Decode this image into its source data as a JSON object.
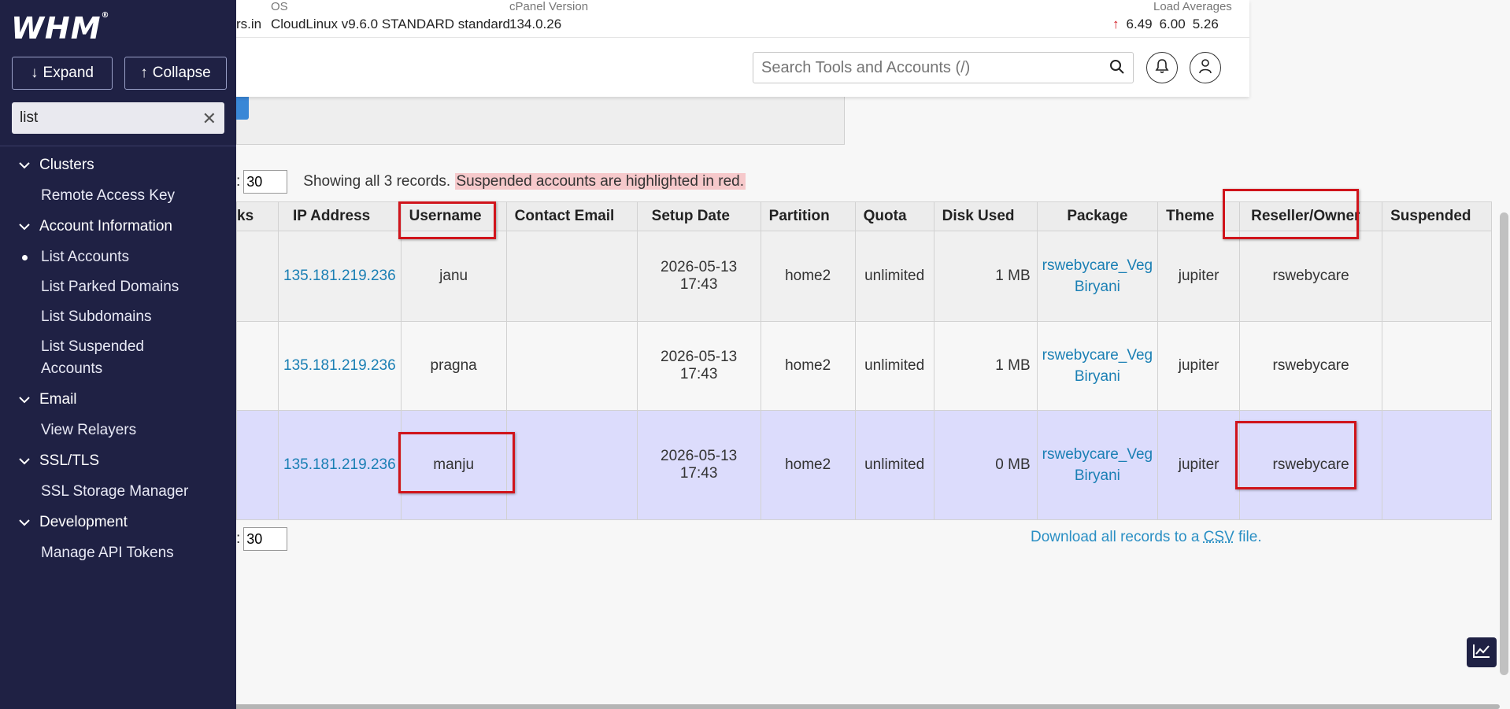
{
  "sidebar": {
    "logo": "WHM",
    "expand_label": "Expand",
    "collapse_label": "Collapse",
    "filter_value": "list",
    "groups": [
      {
        "label": "Clusters",
        "items": [
          "Remote Access Key"
        ]
      },
      {
        "label": "Account Information",
        "items": [
          "List Accounts",
          "List Parked Domains",
          "List Subdomains",
          "List Suspended Accounts"
        ]
      },
      {
        "label": "Email",
        "items": [
          "View Relayers"
        ]
      },
      {
        "label": "SSL/TLS",
        "items": [
          "SSL Storage Manager"
        ]
      },
      {
        "label": "Development",
        "items": [
          "Manage API Tokens"
        ]
      }
    ],
    "active_item": "List Accounts"
  },
  "topbar": {
    "hostname_fragment": "rs.in",
    "os_label": "OS",
    "os_value": "CloudLinux v9.6.0 STANDARD standard",
    "cpanel_label": "cPanel Version",
    "cpanel_value": "134.0.26",
    "load_label": "Load Averages",
    "load_values": [
      "6.49",
      "6.00",
      "5.26"
    ],
    "search_placeholder": "Search Tools and Accounts (/)"
  },
  "pager": {
    "top_value": "30",
    "bottom_value": "30",
    "colon": ":",
    "showing_text": "Showing all 3 records.",
    "suspended_note": "Suspended accounts are highlighted in red."
  },
  "table": {
    "headers": [
      "ks",
      "IP Address",
      "Username",
      "Contact Email",
      "Setup Date",
      "Partition",
      "Quota",
      "Disk Used",
      "Package",
      "Theme",
      "Reseller/Owner",
      "Suspended"
    ],
    "rows": [
      {
        "ip": "135.181.219.236",
        "username": "janu",
        "email": "",
        "setup": "2026-05-13 17:43",
        "partition": "home2",
        "quota": "unlimited",
        "disk": "1 MB",
        "pkg1": "rswebycare_Veg",
        "pkg2": "Biryani",
        "theme": "jupiter",
        "owner": "rswebycare",
        "suspended": ""
      },
      {
        "ip": "135.181.219.236",
        "username": "pragna",
        "email": "",
        "setup": "2026-05-13 17:43",
        "partition": "home2",
        "quota": "unlimited",
        "disk": "1 MB",
        "pkg1": "rswebycare_Veg",
        "pkg2": "Biryani",
        "theme": "jupiter",
        "owner": "rswebycare",
        "suspended": ""
      },
      {
        "ip": "135.181.219.236",
        "username": "manju",
        "email": "",
        "setup": "2026-05-13 17:43",
        "partition": "home2",
        "quota": "unlimited",
        "disk": "0 MB",
        "pkg1": "rswebycare_Veg",
        "pkg2": "Biryani",
        "theme": "jupiter",
        "owner": "rswebycare",
        "suspended": ""
      }
    ]
  },
  "csv": {
    "prefix": "Download all records to a ",
    "abbr": "CSV",
    "suffix": " file."
  },
  "colors": {
    "sidebar_bg": "#1f2144",
    "link": "#1a7fb4",
    "annotation_red": "#d0141b",
    "highlight_row": "#dcdcfc",
    "load_up_arrow": "#d0141b"
  }
}
